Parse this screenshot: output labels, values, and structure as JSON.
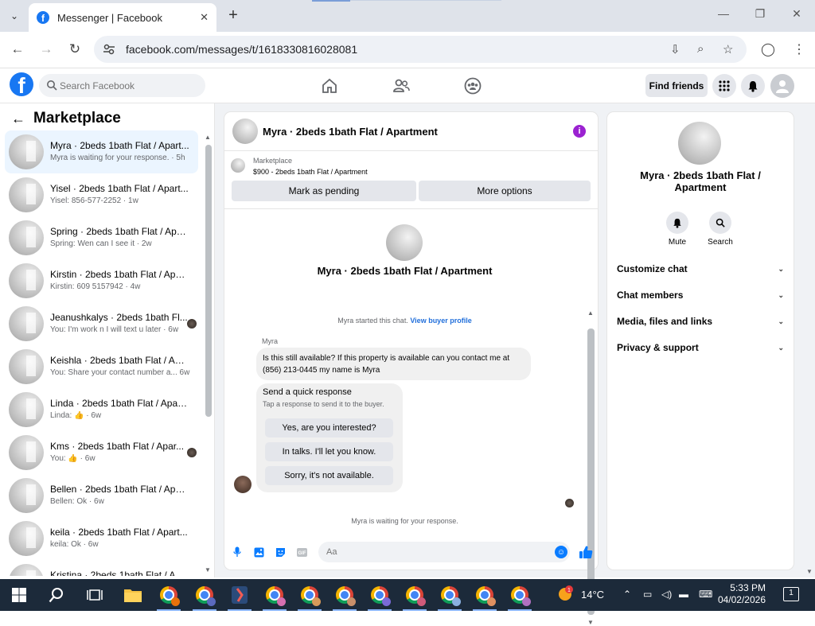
{
  "browser": {
    "tab_title": "Messenger | Facebook",
    "url": "facebook.com/messages/t/1618330816028081"
  },
  "fb": {
    "search_placeholder": "Search Facebook",
    "find_friends": "Find friends"
  },
  "left": {
    "title": "Marketplace",
    "conversations": [
      {
        "name": "Myra · 2beds 1bath Flat / Apart...",
        "preview": "Myra is waiting for your response. · 5h"
      },
      {
        "name": "Yisel · 2beds 1bath Flat / Apart...",
        "preview": "Yisel: 856-577-2252 · 1w"
      },
      {
        "name": "Spring · 2beds 1bath Flat / Apar...",
        "preview": "Spring: Wen can I see it · 2w"
      },
      {
        "name": "Kirstin · 2beds 1bath Flat / Apar...",
        "preview": "Kirstin: 609 5157942 · 4w"
      },
      {
        "name": "Jeanushkalys · 2beds 1bath Fl...",
        "preview": "You: I'm work n I will text u later · 6w"
      },
      {
        "name": "Keishla · 2beds 1bath Flat / Apa...",
        "preview": "You: Share your contact number a...   6w"
      },
      {
        "name": "Linda · 2beds 1bath Flat / Apart...",
        "preview": "Linda: 👍 · 6w"
      },
      {
        "name": "Kms · 2beds 1bath Flat / Apar...",
        "preview": "You: 👍 · 6w"
      },
      {
        "name": "Bellen · 2beds 1bath Flat / Apar...",
        "preview": "Bellen: Ok · 6w"
      },
      {
        "name": "keila · 2beds 1bath Flat / Apart...",
        "preview": "keila: Ok · 6w"
      },
      {
        "name": "Kristina · 2beds 1bath Flat / A...",
        "preview": ""
      }
    ]
  },
  "chat": {
    "header_name": "Myra · 2beds 1bath Flat / Apartment",
    "market_label": "Marketplace",
    "market_listing": "$900 - 2beds 1bath Flat / Apartment",
    "mark_pending": "Mark as pending",
    "more_options": "More options",
    "profile_name": "Myra · 2beds 1bath Flat / Apartment",
    "started_text": "Myra started this chat.",
    "view_buyer": "View buyer profile",
    "sender": "Myra",
    "message": "Is this still available? If this property is available can you contact me at (856) 213-0445 my name is Myra",
    "quick_title": "Send a quick response",
    "quick_sub": "Tap a response to send it to the buyer.",
    "quick_options": [
      "Yes, are you interested?",
      "In talks. I'll let you know.",
      "Sorry, it's not available."
    ],
    "waiting": "Myra is waiting for your response.",
    "composer_placeholder": "Aa"
  },
  "right": {
    "name": "Myra · 2beds 1bath Flat / Apartment",
    "mute": "Mute",
    "search": "Search",
    "sections": [
      "Customize chat",
      "Chat members",
      "Media, files and links",
      "Privacy & support"
    ]
  },
  "taskbar": {
    "weather": "14°C",
    "time": "5:33 PM",
    "date": "04/02/2026",
    "notif_count": "1",
    "badge": "1"
  },
  "colors": {
    "fb_blue": "#1877f2",
    "messenger_blue": "#0a7cff",
    "info_purple": "#9b22d1"
  }
}
